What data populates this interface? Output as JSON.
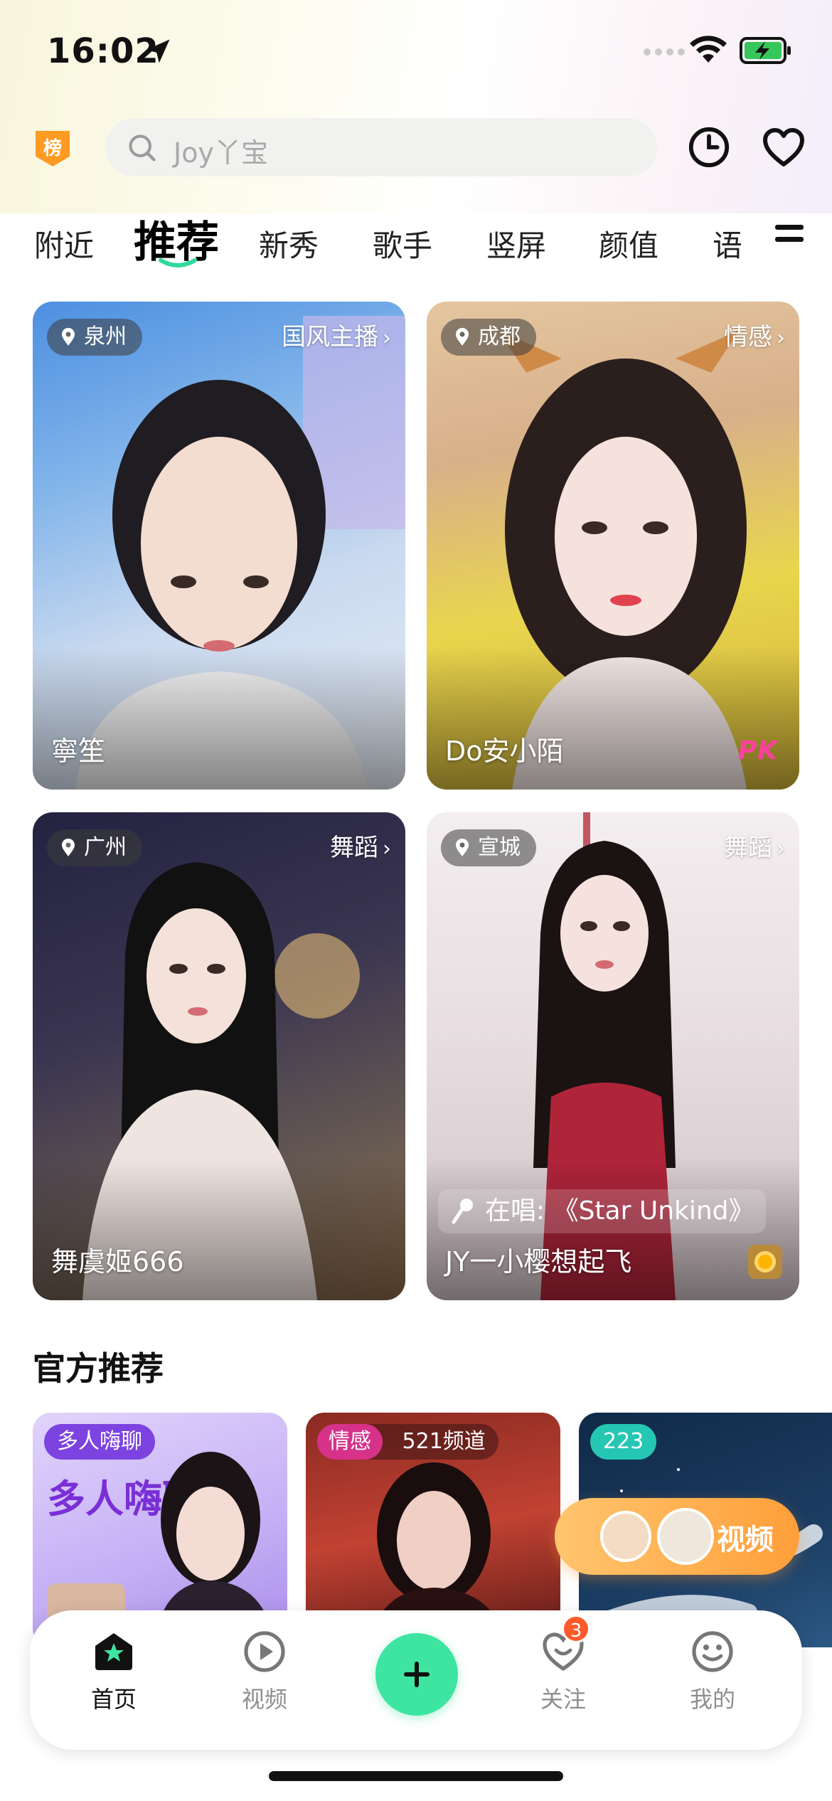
{
  "status_bar": {
    "time": "16:02"
  },
  "header": {
    "rank_badge": "榜",
    "search_placeholder": "Joy丫宝"
  },
  "tabs": [
    {
      "label": "附近"
    },
    {
      "label": "推荐",
      "active": true
    },
    {
      "label": "新秀"
    },
    {
      "label": "歌手"
    },
    {
      "label": "竖屏"
    },
    {
      "label": "颜值"
    },
    {
      "label": "语"
    }
  ],
  "streams": [
    {
      "location": "泉州",
      "category": "国风主播",
      "name": "寧笙"
    },
    {
      "location": "成都",
      "category": "情感",
      "name": "Do安小陌",
      "badge": "PK"
    },
    {
      "location": "广州",
      "category": "舞蹈",
      "name": "舞虞姬666"
    },
    {
      "location": "宣城",
      "category": "舞蹈",
      "name": "JY一小樱想起飞",
      "singing": "在唱: 《Star Unkind》"
    }
  ],
  "official": {
    "title": "官方推荐",
    "cards": [
      {
        "tag": "多人嗨聊",
        "art_text": "多人嗨聊"
      },
      {
        "tag": "情感",
        "channel": "521频道"
      },
      {
        "tag": "223"
      }
    ]
  },
  "float_button": {
    "label": "视频"
  },
  "tab_bar": {
    "items": [
      {
        "label": "首页",
        "active": true
      },
      {
        "label": "视频"
      },
      {
        "label": "关注",
        "badge": "3"
      },
      {
        "label": "我的"
      }
    ]
  },
  "colors": {
    "accent": "#3ee5a0",
    "badge": "#ff5a2b",
    "float": "#ff9f3a"
  }
}
